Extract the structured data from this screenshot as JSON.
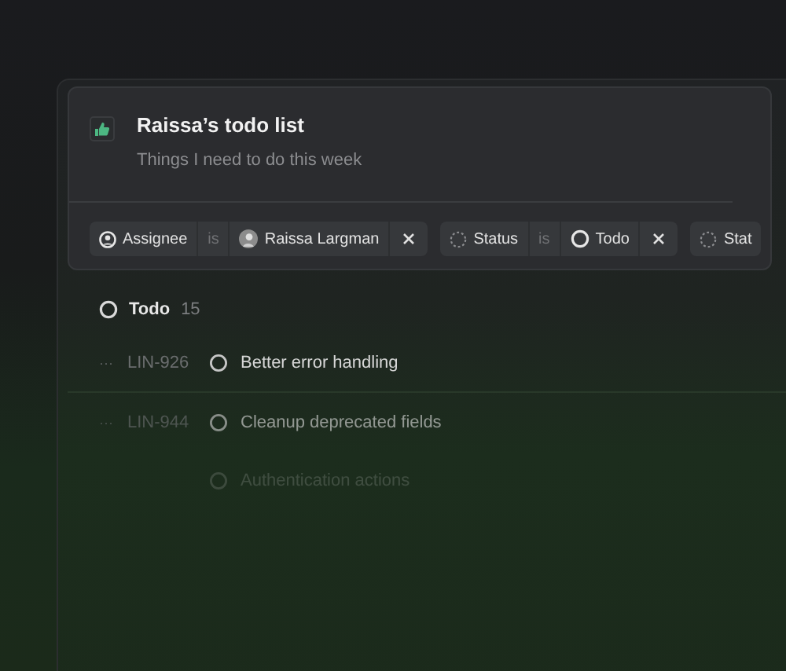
{
  "view": {
    "title": "Raissa’s todo list",
    "description": "Things I need to do this week"
  },
  "filters": [
    {
      "kind": "assignee",
      "field": "Assignee",
      "operator": "is",
      "value": {
        "kind": "avatar",
        "text": "Raissa Largman"
      },
      "removable": true
    },
    {
      "kind": "status",
      "field": "Status",
      "operator": "is",
      "value": {
        "kind": "status",
        "text": "Todo"
      },
      "removable": true
    },
    {
      "kind": "status",
      "field": "Stat"
    }
  ],
  "group": {
    "label": "Todo",
    "count": "15"
  },
  "issues": [
    {
      "menu": "···",
      "id": "LIN-926",
      "title": "Better error handling"
    },
    {
      "menu": "···",
      "id": "LIN-944",
      "title": "Cleanup deprecated fields"
    },
    {
      "title": "Authentication actions"
    }
  ]
}
